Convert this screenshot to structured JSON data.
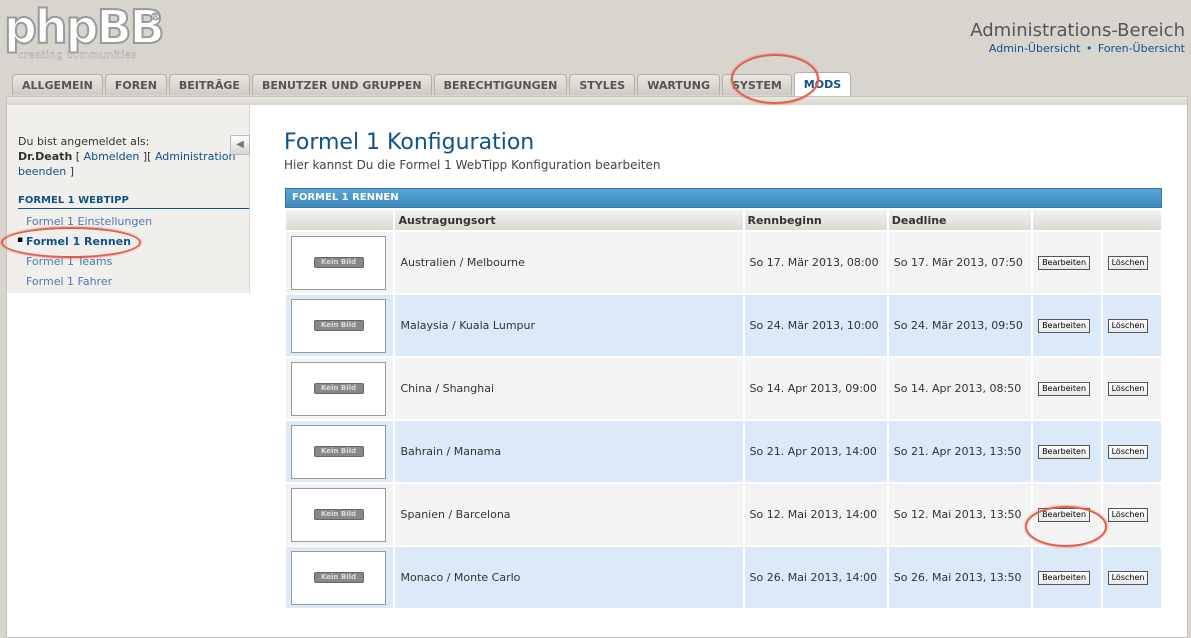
{
  "header": {
    "logo_text": "phpBB",
    "logo_reg": "®",
    "logo_tagline": "creating  communities",
    "admin_title": "Administrations-Bereich",
    "links": [
      "Admin-Übersicht",
      "Foren-Übersicht"
    ],
    "link_separator": "•"
  },
  "tabs": [
    {
      "label": "ALLGEMEIN"
    },
    {
      "label": "FOREN"
    },
    {
      "label": "BEITRÄGE"
    },
    {
      "label": "BENUTZER UND GRUPPEN"
    },
    {
      "label": "BERECHTIGUNGEN"
    },
    {
      "label": "STYLES"
    },
    {
      "label": "WARTUNG"
    },
    {
      "label": "SYSTEM"
    },
    {
      "label": "MODS",
      "active": true
    }
  ],
  "sidebar": {
    "logged_prefix": "Du bist angemeldet als:",
    "username": "Dr.Death",
    "logout_open": " [ ",
    "logout": "Abmelden",
    "logout_close": " ][ ",
    "admin_end": "Administration beenden",
    "end_bracket": " ]",
    "collapse_icon": "◀",
    "section": "FORMEL 1 WEBTIPP",
    "items": [
      {
        "label": "Formel 1 Einstellungen"
      },
      {
        "label": "Formel 1 Rennen",
        "active": true
      },
      {
        "label": "Formel 1 Teams"
      },
      {
        "label": "Formel 1 Fahrer"
      }
    ],
    "active_bullet": "▪"
  },
  "main": {
    "title": "Formel 1 Konfiguration",
    "description": "Hier kannst Du die Formel 1 WebTipp Konfiguration bearbeiten",
    "table_caption": "FORMEL 1 RENNEN",
    "columns": [
      "",
      "Austragungsort",
      "Rennbeginn",
      "Deadline",
      ""
    ],
    "image_placeholder": "Kein Bild",
    "edit_label": "Bearbeiten",
    "delete_label": "Löschen",
    "rows": [
      {
        "location": "Australien / Melbourne",
        "start": "So 17. Mär 2013, 08:00",
        "deadline": "So 17. Mär 2013, 07:50"
      },
      {
        "location": "Malaysia / Kuala Lumpur",
        "start": "So 24. Mär 2013, 10:00",
        "deadline": "So 24. Mär 2013, 09:50"
      },
      {
        "location": "China / Shanghai",
        "start": "So 14. Apr 2013, 09:00",
        "deadline": "So 14. Apr 2013, 08:50"
      },
      {
        "location": "Bahrain / Manama",
        "start": "So 21. Apr 2013, 14:00",
        "deadline": "So 21. Apr 2013, 13:50"
      },
      {
        "location": "Spanien / Barcelona",
        "start": "So 12. Mai 2013, 14:00",
        "deadline": "So 12. Mai 2013, 13:50"
      },
      {
        "location": "Monaco / Monte Carlo",
        "start": "So 26. Mai 2013, 14:00",
        "deadline": "So 26. Mai 2013, 13:50"
      }
    ]
  },
  "colors": {
    "accent": "#105289",
    "highlight_ring": "#e0604e",
    "row_odd": "#f3f3f3",
    "row_even": "#dce9f8",
    "caption_bar": "#4a96c8"
  }
}
